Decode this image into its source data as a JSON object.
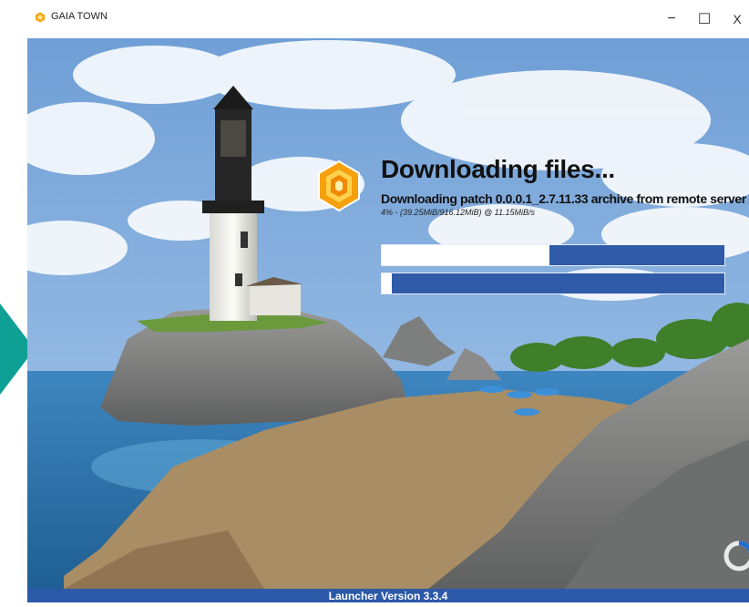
{
  "window": {
    "title": "GAIA TOWN",
    "icon": "gaia-logo-icon",
    "controls": {
      "minimize": "−",
      "maximize": "☐",
      "close": "X"
    }
  },
  "download": {
    "heading": "Downloading files...",
    "status": "Downloading patch 0.0.0.1_2.7.11.33 archive from remote server",
    "stats": "4% - (39.25MiB/916.12MiB) @ 11.15MiB/s",
    "file_progress": 0.49,
    "total_progress": 0.03
  },
  "footer": {
    "version": "Launcher Version 3.3.4"
  },
  "colors": {
    "accent": "#2f5ba8",
    "footer": "#2c5aa8",
    "logo": "#f2a30c",
    "side_arrow": "#0e9f95"
  }
}
